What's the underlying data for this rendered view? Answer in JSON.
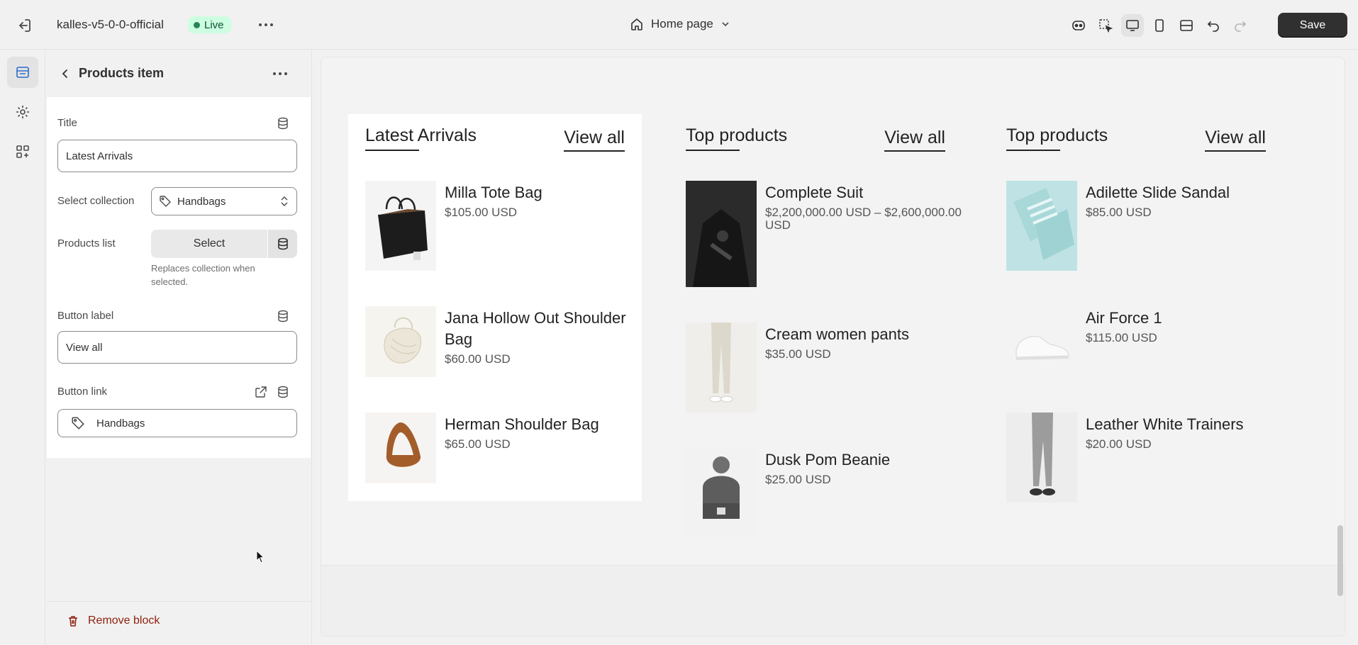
{
  "topbar": {
    "store_name": "kalles-v5-0-0-official",
    "status": "Live",
    "page": "Home page",
    "save_label": "Save",
    "status_color": "#29845a"
  },
  "panel": {
    "title": "Products item",
    "fields": {
      "title_label": "Title",
      "title_value": "Latest Arrivals",
      "collection_label": "Select collection",
      "collection_value": "Handbags",
      "products_list_label": "Products list",
      "select_label": "Select",
      "products_help": "Replaces collection when selected.",
      "button_label_label": "Button label",
      "button_label_value": "View all",
      "button_link_label": "Button link",
      "button_link_value": "Handbags"
    },
    "remove_label": "Remove block",
    "danger_color": "#8e1f0b"
  },
  "preview": {
    "columns": [
      {
        "title": "Latest Arrivals",
        "view_all": "View all",
        "products": [
          {
            "name": "Milla Tote Bag",
            "price": "$105.00 USD",
            "image": "black-tote-bag-icon"
          },
          {
            "name": "Jana Hollow Out Shoulder Bag",
            "price": "$60.00 USD",
            "image": "white-shoulder-bag-icon"
          },
          {
            "name": "Herman Shoulder Bag",
            "price": "$65.00 USD",
            "image": "brown-shoulder-bag-icon"
          }
        ]
      },
      {
        "title": "Top products",
        "view_all": "View all",
        "products": [
          {
            "name": "Complete Suit",
            "price": "$2,200,000.00 USD – $2,600,000.00 USD",
            "image": "suit-photo-icon"
          },
          {
            "name": "Cream women pants",
            "price": "$35.00 USD",
            "image": "pants-photo-icon"
          },
          {
            "name": "Dusk Pom Beanie",
            "price": "$25.00 USD",
            "image": "beanie-photo-icon"
          }
        ]
      },
      {
        "title": "Top products",
        "view_all": "View all",
        "products": [
          {
            "name": "Adilette Slide Sandal",
            "price": "$85.00 USD",
            "image": "sandal-photo-icon"
          },
          {
            "name": "Air Force 1",
            "price": "$115.00 USD",
            "image": "sneaker-photo-icon"
          },
          {
            "name": "Leather White Trainers",
            "price": "$20.00 USD",
            "image": "trainers-photo-icon"
          }
        ]
      }
    ]
  }
}
